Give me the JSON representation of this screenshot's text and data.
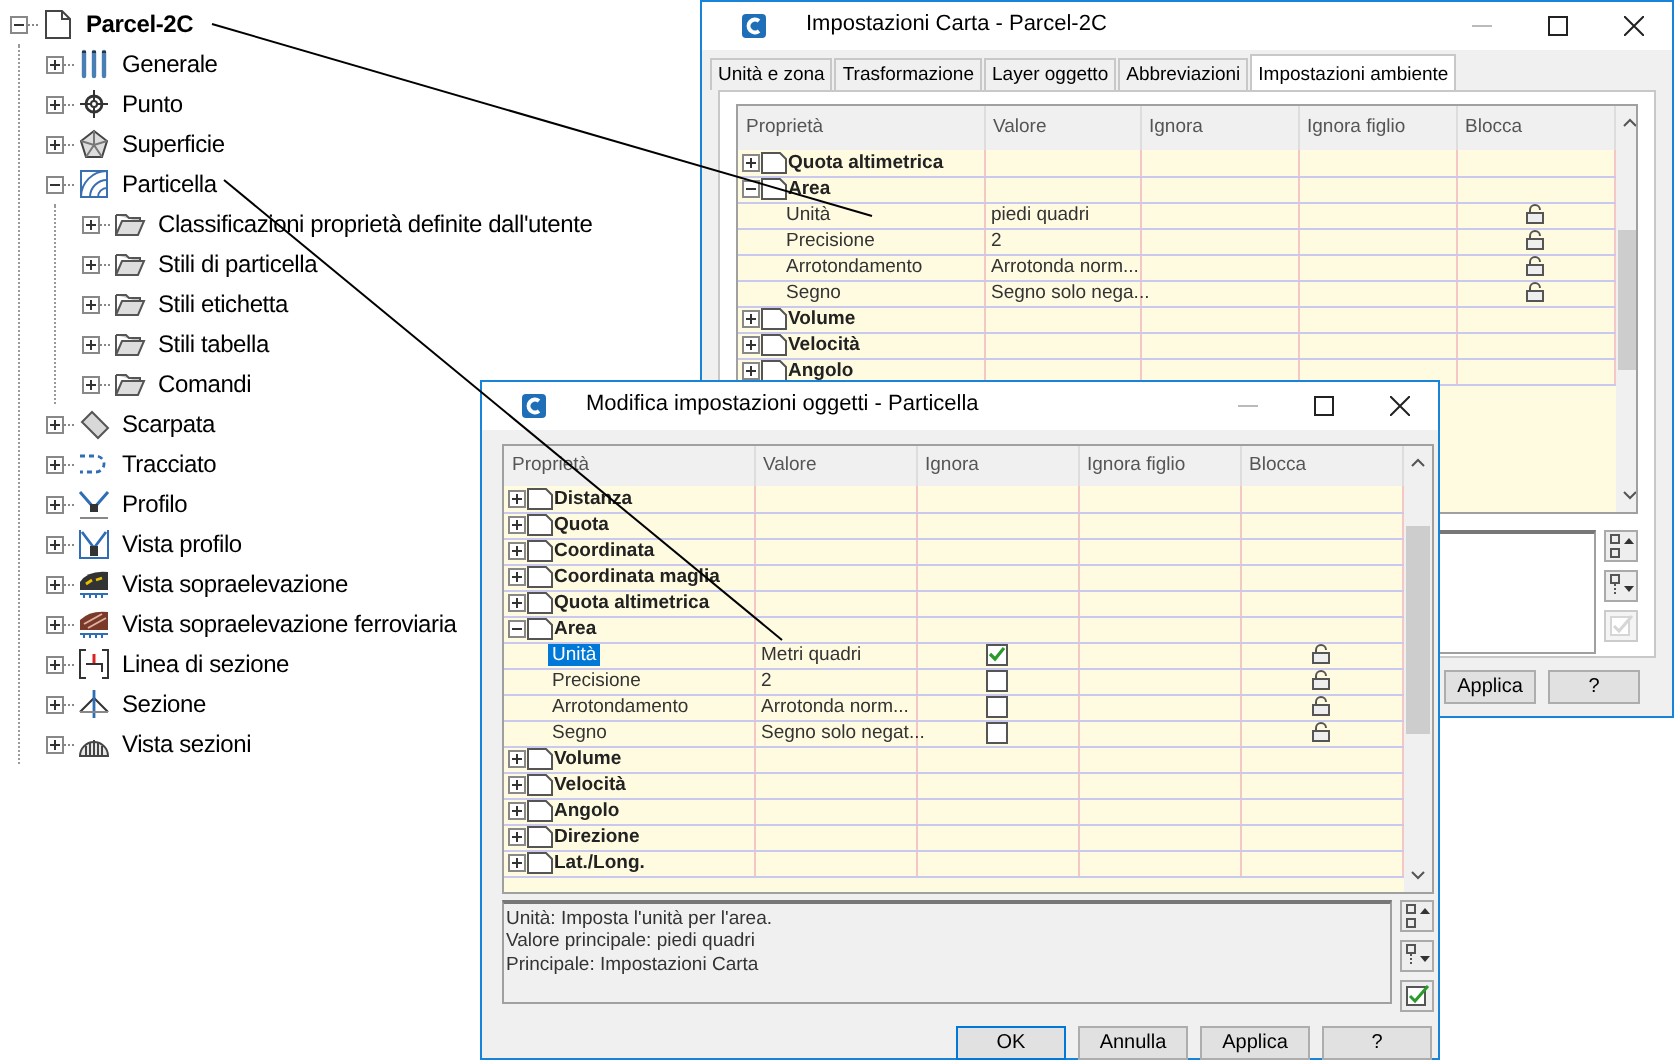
{
  "tree": {
    "label": "Parcel-2C",
    "kind": "drawing",
    "expanded": true,
    "children": [
      {
        "label": "Generale",
        "kind": "general",
        "expanded": false
      },
      {
        "label": "Punto",
        "kind": "point",
        "expanded": false
      },
      {
        "label": "Superficie",
        "kind": "surface",
        "expanded": false
      },
      {
        "label": "Particella",
        "kind": "parcel",
        "expanded": true,
        "children": [
          {
            "label": "Classificazioni proprietà definite dall'utente",
            "kind": "folder",
            "expanded": false
          },
          {
            "label": "Stili di particella",
            "kind": "folder",
            "expanded": false
          },
          {
            "label": "Stili etichetta",
            "kind": "folder",
            "expanded": false
          },
          {
            "label": "Stili tabella",
            "kind": "folder",
            "expanded": false
          },
          {
            "label": "Comandi",
            "kind": "folder",
            "expanded": false
          }
        ]
      },
      {
        "label": "Scarpata",
        "kind": "slope",
        "expanded": false
      },
      {
        "label": "Tracciato",
        "kind": "alignment",
        "expanded": false
      },
      {
        "label": "Profilo",
        "kind": "profile",
        "expanded": false
      },
      {
        "label": "Vista profilo",
        "kind": "profile_view",
        "expanded": false
      },
      {
        "label": "Vista sopraelevazione",
        "kind": "elevation_view",
        "expanded": false
      },
      {
        "label": "Vista sopraelevazione ferroviaria",
        "kind": "rail_elevation_view",
        "expanded": false
      },
      {
        "label": "Linea di sezione",
        "kind": "section_line",
        "expanded": false
      },
      {
        "label": "Sezione",
        "kind": "section",
        "expanded": false
      },
      {
        "label": "Vista sezioni",
        "kind": "section_view",
        "expanded": false
      }
    ]
  },
  "back_window": {
    "title": "Impostazioni Carta - Parcel-2C",
    "tabs": [
      {
        "label": "Unità e zona",
        "selected": false
      },
      {
        "label": "Trasformazione",
        "selected": false
      },
      {
        "label": "Layer oggetto",
        "selected": false
      },
      {
        "label": "Abbreviazioni",
        "selected": false
      },
      {
        "label": "Impostazioni ambiente",
        "selected": true
      }
    ],
    "columns": [
      "Proprietà",
      "Valore",
      "Ignora",
      "Ignora figlio",
      "Blocca"
    ],
    "rows": [
      {
        "label": "Quota altimetrica",
        "expanded": false
      },
      {
        "label": "Area",
        "expanded": true,
        "children": [
          {
            "label": "Unità",
            "value": "piedi quadri"
          },
          {
            "label": "Precisione",
            "value": "2"
          },
          {
            "label": "Arrotondamento",
            "value": "Arrotonda norm..."
          },
          {
            "label": "Segno",
            "value": "Segno solo nega..."
          }
        ]
      },
      {
        "label": "Volume",
        "expanded": false
      },
      {
        "label": "Velocità",
        "expanded": false
      },
      {
        "label": "Angolo",
        "expanded": false
      }
    ],
    "buttons": [
      "Applica",
      "?"
    ]
  },
  "front_window": {
    "title": "Modifica impostazioni oggetti - Particella",
    "columns": [
      "Proprietà",
      "Valore",
      "Ignora",
      "Ignora figlio",
      "Blocca"
    ],
    "rows": [
      {
        "label": "Distanza",
        "expanded": false
      },
      {
        "label": "Quota",
        "expanded": false
      },
      {
        "label": "Coordinata",
        "expanded": false
      },
      {
        "label": "Coordinata maglia",
        "expanded": false
      },
      {
        "label": "Quota altimetrica",
        "expanded": false
      },
      {
        "label": "Area",
        "expanded": true,
        "children": [
          {
            "label": "Unità",
            "value": "Metri quadri",
            "checked": true,
            "selected": true
          },
          {
            "label": "Precisione",
            "value": "2",
            "checked": false,
            "selected": false
          },
          {
            "label": "Arrotondamento",
            "value": "Arrotonda norm...",
            "checked": false,
            "selected": false
          },
          {
            "label": "Segno",
            "value": "Segno solo negat...",
            "checked": false,
            "selected": false
          }
        ]
      },
      {
        "label": "Volume",
        "expanded": false
      },
      {
        "label": "Velocità",
        "expanded": false
      },
      {
        "label": "Angolo",
        "expanded": false
      },
      {
        "label": "Direzione",
        "expanded": false
      },
      {
        "label": "Lat./Long.",
        "expanded": false
      }
    ],
    "description": [
      "Unità: Imposta l'unità per l'area.",
      "Valore principale: piedi quadri",
      "Principale: Impostazioni Carta"
    ],
    "buttons": [
      "OK",
      "Annulla",
      "Applica",
      "?"
    ]
  }
}
